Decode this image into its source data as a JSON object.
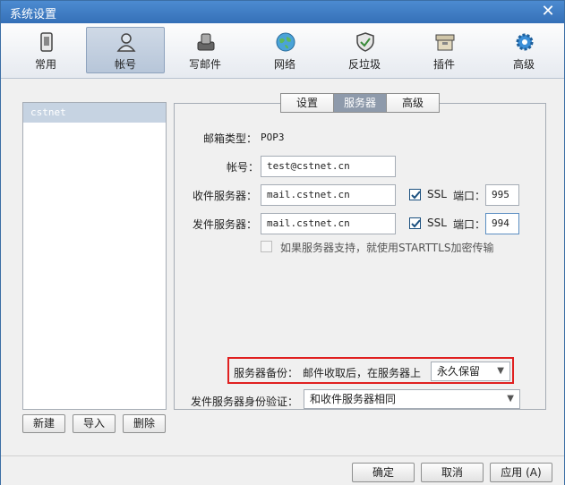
{
  "window": {
    "title": "系统设置"
  },
  "toolbar": {
    "items": [
      {
        "label": "常用",
        "icon": "phone-icon"
      },
      {
        "label": "帐号",
        "icon": "user-icon"
      },
      {
        "label": "写邮件",
        "icon": "compose-icon"
      },
      {
        "label": "网络",
        "icon": "globe-icon"
      },
      {
        "label": "反垃圾",
        "icon": "shield-icon"
      },
      {
        "label": "插件",
        "icon": "box-icon"
      },
      {
        "label": "高级",
        "icon": "gear-icon"
      }
    ],
    "active": "帐号"
  },
  "accounts": {
    "items": [
      "cstnet"
    ],
    "new_label": "新建",
    "import_label": "导入",
    "delete_label": "删除"
  },
  "tabs": {
    "settings": "设置",
    "server": "服务器",
    "advanced": "高级",
    "active": "服务器"
  },
  "form": {
    "mailbox_type_label": "邮箱类型：",
    "mailbox_type_value": "POP3",
    "account_label": "帐号：",
    "account_value": "test@cstnet.cn",
    "incoming_label": "收件服务器：",
    "incoming_value": "mail.cstnet.cn",
    "incoming_ssl": "SSL",
    "incoming_port_label": "端口：",
    "incoming_port": "995",
    "outgoing_label": "发件服务器：",
    "outgoing_value": "mail.cstnet.cn",
    "outgoing_ssl": "SSL",
    "outgoing_port_label": "端口：",
    "outgoing_port": "994",
    "starttls_label": "如果服务器支持，就使用STARTTLS加密传输",
    "backup_label": "服务器备份：",
    "backup_desc": "邮件收取后，在服务器上",
    "backup_value": "永久保留",
    "auth_label": "发件服务器身份验证：",
    "auth_value": "和收件服务器相同"
  },
  "buttons": {
    "ok": "确定",
    "cancel": "取消",
    "apply": "应用 (A)"
  },
  "colors": {
    "title_bar": "#3570b8",
    "highlight": "#e02020",
    "active_tab": "#8e9aab",
    "checkbox": "#1c5180"
  }
}
